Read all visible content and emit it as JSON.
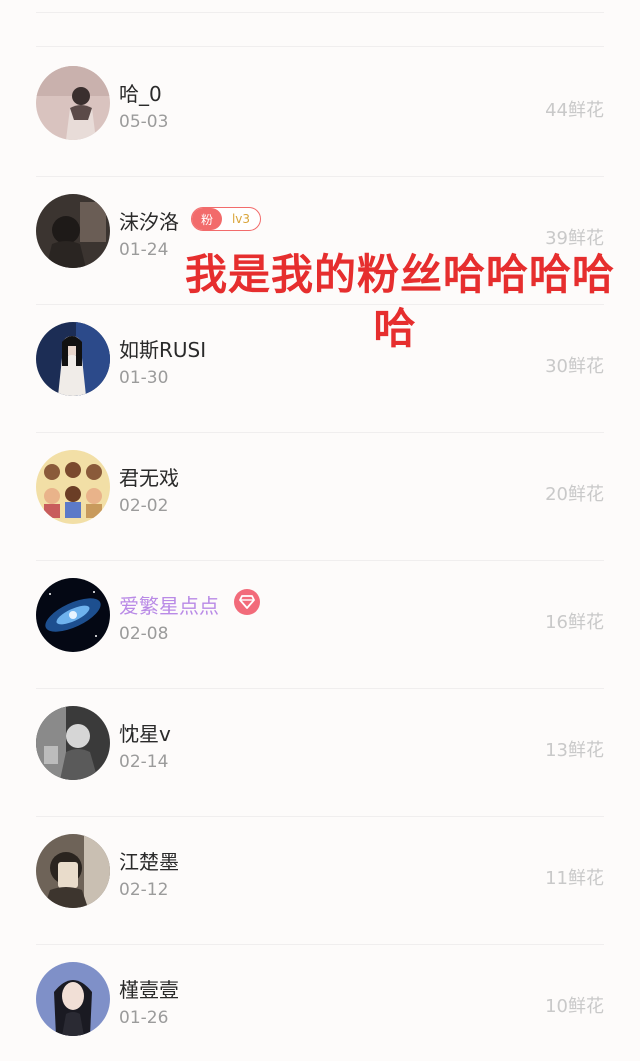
{
  "list": [
    {
      "name": "哈_0",
      "date": "05-03",
      "flowers": "44鲜花",
      "avatar_icon": "user-avatar"
    },
    {
      "name": "沫汐洛",
      "date": "01-24",
      "flowers": "39鲜花",
      "avatar_icon": "user-avatar",
      "fan_badge": {
        "fan": "粉",
        "level": "lv3"
      }
    },
    {
      "name": "如斯RUSI",
      "date": "01-30",
      "flowers": "30鲜花",
      "avatar_icon": "user-avatar"
    },
    {
      "name": "君无戏",
      "date": "02-02",
      "flowers": "20鲜花",
      "avatar_icon": "user-avatar"
    },
    {
      "name": "爱繁星点点",
      "date": "02-08",
      "flowers": "16鲜花",
      "avatar_icon": "user-avatar",
      "vip_icon": "diamond-icon"
    },
    {
      "name": "忱星v",
      "date": "02-14",
      "flowers": "13鲜花",
      "avatar_icon": "user-avatar"
    },
    {
      "name": "江楚墨",
      "date": "02-12",
      "flowers": "11鲜花",
      "avatar_icon": "user-avatar"
    },
    {
      "name": "槿壹壹",
      "date": "01-26",
      "flowers": "10鲜花",
      "avatar_icon": "user-avatar"
    }
  ],
  "overlay_text": {
    "line1": "我是我的粉丝哈哈哈哈",
    "line2": "哈"
  },
  "colors": {
    "background": "#fdfbfa",
    "name_text": "#2a2a2a",
    "vip_name_text": "#b98ae6",
    "date_text": "#9b9b9b",
    "flowers_text": "#c9c9c9",
    "fan_badge": "#f26b6b",
    "level_text": "#d9a53a",
    "overlay_text": "#e62e2e"
  }
}
